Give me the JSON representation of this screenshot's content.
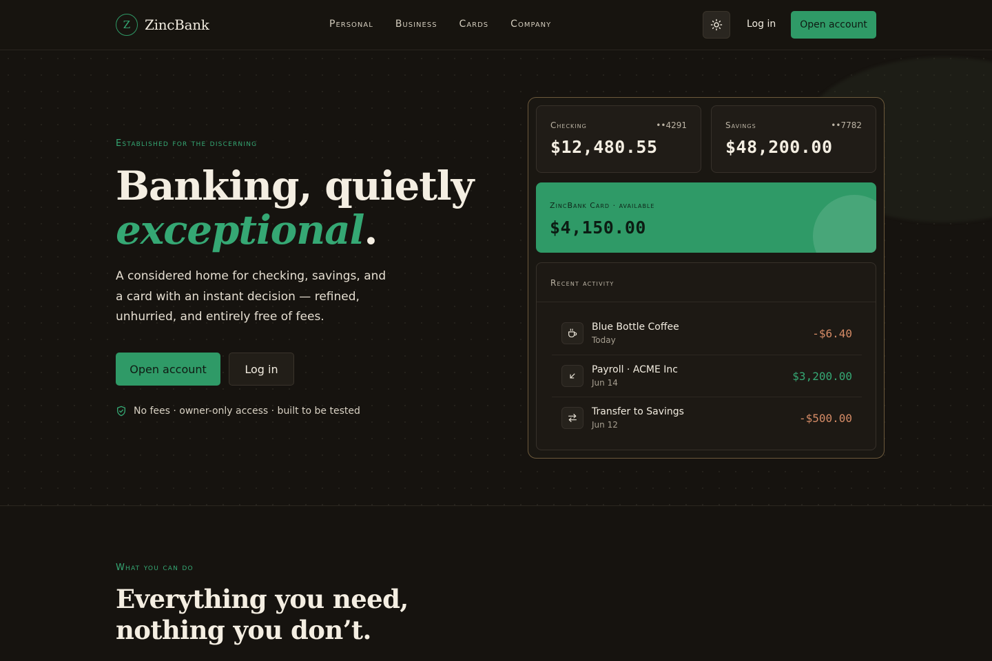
{
  "brand": {
    "mark": "Z",
    "name": "ZincBank"
  },
  "nav": {
    "items": [
      "Personal",
      "Business",
      "Cards",
      "Company"
    ]
  },
  "header": {
    "login": "Log in",
    "open_account": "Open account"
  },
  "hero": {
    "eyebrow": "Established for the discerning",
    "title_line1": "Banking, quietly",
    "title_accent": "exceptional",
    "title_period": ".",
    "lede": "A considered home for checking, savings, and a card with an instant decision — refined, unhurried, and entirely free of fees.",
    "cta_primary": "Open account",
    "cta_secondary": "Log in",
    "trust": "No fees · owner-only access · built to be tested"
  },
  "dashboard": {
    "checking": {
      "label": "Checking",
      "number": "••4291",
      "balance": "$12,480.55"
    },
    "savings": {
      "label": "Savings",
      "number": "••7782",
      "balance": "$48,200.00"
    },
    "card": {
      "label": "ZincBank Card · available",
      "balance": "$4,150.00"
    },
    "activity_title": "Recent activity",
    "transactions": [
      {
        "name": "Blue Bottle Coffee",
        "date": "Today",
        "amount": "-$6.40",
        "icon": "coffee-icon",
        "direction": "debit"
      },
      {
        "name": "Payroll · ACME Inc",
        "date": "Jun 14",
        "amount": "$3,200.00",
        "icon": "arrow-down-left-icon",
        "direction": "credit"
      },
      {
        "name": "Transfer to Savings",
        "date": "Jun 12",
        "amount": "-$500.00",
        "icon": "transfer-icon",
        "direction": "debit"
      }
    ]
  },
  "features": {
    "eyebrow": "What you can do",
    "title_line1": "Everything you need,",
    "title_line2": "nothing you don’t."
  },
  "colors": {
    "accent": "#2f9a67",
    "background": "#16130f",
    "debit": "#d58b66",
    "border_gold": "#6d5a3c"
  }
}
